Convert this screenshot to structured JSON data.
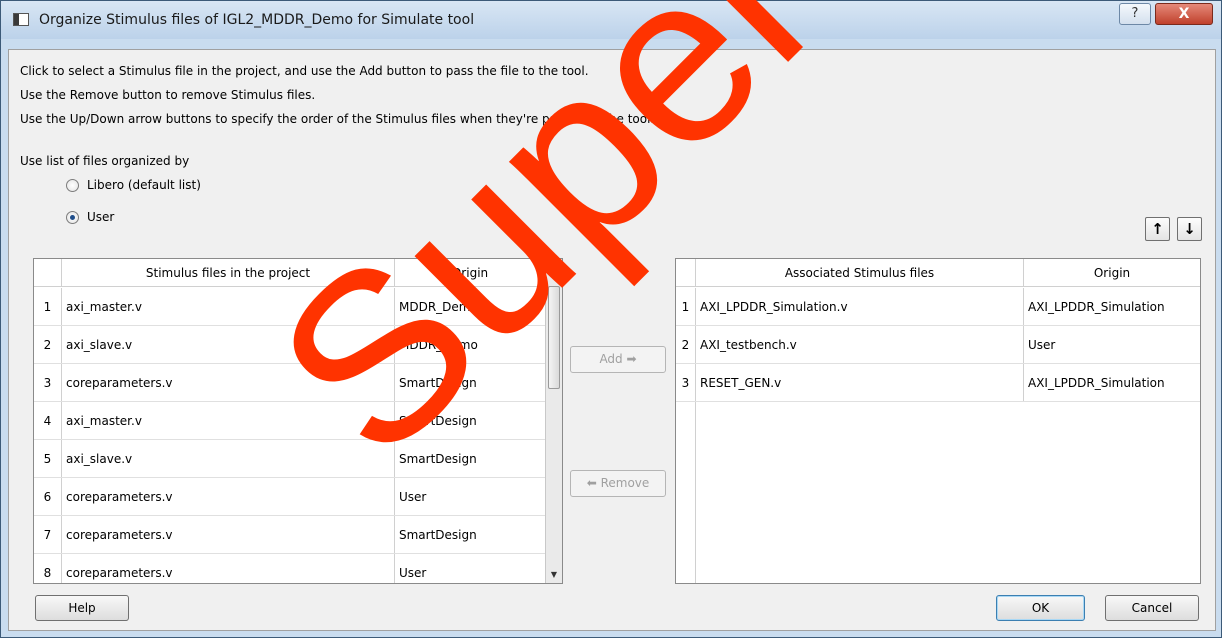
{
  "window": {
    "title": "Organize Stimulus files of IGL2_MDDR_Demo for Simulate tool",
    "help_label": "?",
    "close_label": "X"
  },
  "instructions": {
    "line1": "Click to select a Stimulus file in the project, and use the Add button to pass the file to the tool.",
    "line2": "Use the Remove button to remove Stimulus files.",
    "line3": "Use the Up/Down arrow buttons to specify the order of the Stimulus files when they're passed to the tool."
  },
  "organize": {
    "label": "Use list of files organized by",
    "options": [
      {
        "label": "Libero (default list)",
        "checked": false
      },
      {
        "label": "User",
        "checked": true
      }
    ]
  },
  "order_buttons": {
    "up": "↑",
    "down": "↓"
  },
  "left_table": {
    "columns": [
      "Stimulus files in the project",
      "Origin"
    ],
    "rows": [
      {
        "num": "1",
        "file": "axi_master.v",
        "origin": "MDDR_Demo"
      },
      {
        "num": "2",
        "file": "axi_slave.v",
        "origin": "MDDR_Demo"
      },
      {
        "num": "3",
        "file": "coreparameters.v",
        "origin": "SmartDesign"
      },
      {
        "num": "4",
        "file": "axi_master.v",
        "origin": "SmartDesign"
      },
      {
        "num": "5",
        "file": "axi_slave.v",
        "origin": "SmartDesign"
      },
      {
        "num": "6",
        "file": "coreparameters.v",
        "origin": "User"
      },
      {
        "num": "7",
        "file": "coreparameters.v",
        "origin": "SmartDesign"
      },
      {
        "num": "8",
        "file": "coreparameters.v",
        "origin": "User"
      }
    ]
  },
  "right_table": {
    "columns": [
      "Associated Stimulus files",
      "Origin"
    ],
    "rows": [
      {
        "num": "1",
        "file": "AXI_LPDDR_Simulation.v",
        "origin": "AXI_LPDDR_Simulation"
      },
      {
        "num": "2",
        "file": "AXI_testbench.v",
        "origin": "User"
      },
      {
        "num": "3",
        "file": "RESET_GEN.v",
        "origin": "AXI_LPDDR_Simulation"
      }
    ]
  },
  "actions": {
    "add": "Add ➡",
    "remove": "⬅ Remove"
  },
  "footer": {
    "help": "Help",
    "ok": "OK",
    "cancel": "Cancel"
  },
  "watermark": {
    "text": "Super",
    "color": "#ff3300"
  }
}
